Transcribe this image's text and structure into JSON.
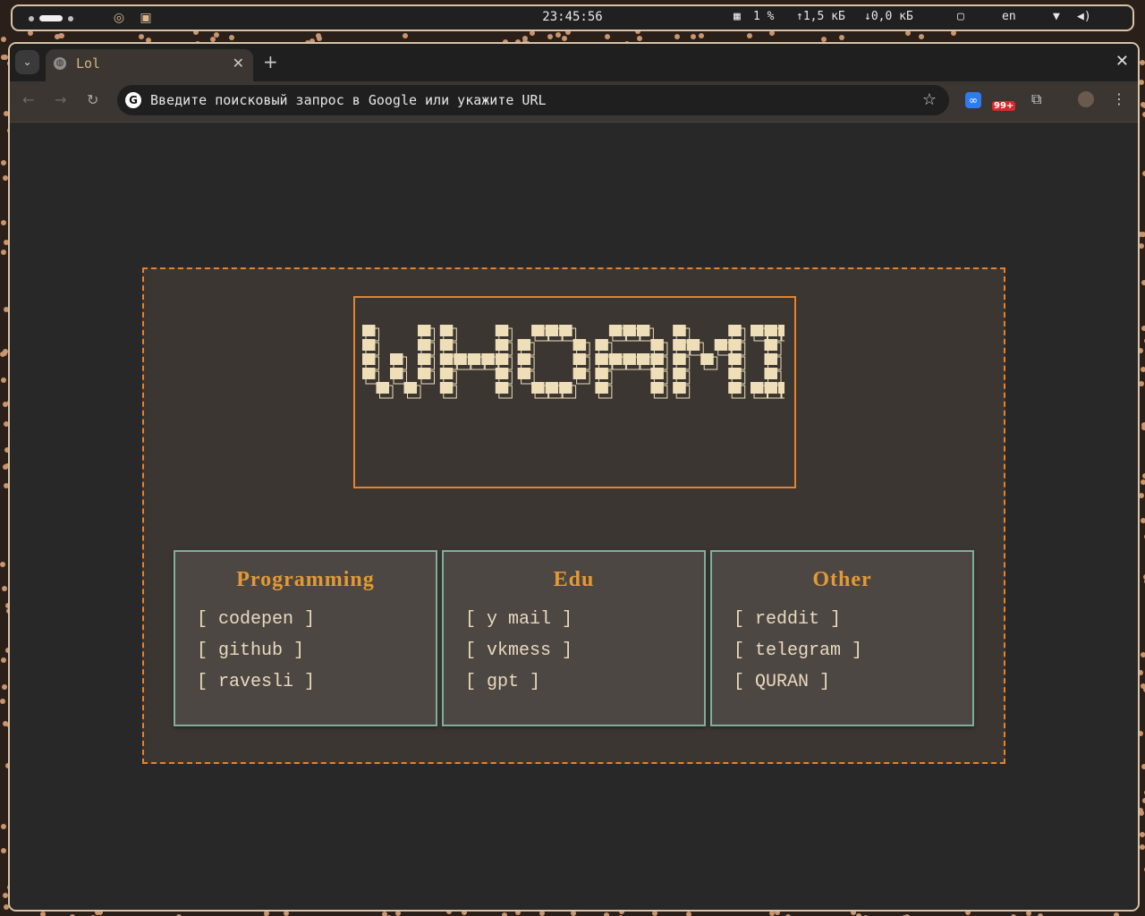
{
  "system_bar": {
    "clock": "23:45:56",
    "cpu": "1 %",
    "upload": "↑1,5 кБ",
    "download": "↓0,0 кБ",
    "layout": "en"
  },
  "browser": {
    "tab_title": "Lol",
    "omnibox_placeholder": "Введите поисковый запрос в Google или укажите URL",
    "extension_badge": "99+"
  },
  "page": {
    "banner_text": "WHOAMI",
    "sections": [
      {
        "title": "Programming",
        "links": [
          "codepen",
          "github",
          "ravesli"
        ]
      },
      {
        "title": "Edu",
        "links": [
          "y mail",
          "vkmess",
          "gpt"
        ]
      },
      {
        "title": "Other",
        "links": [
          "reddit",
          "telegram",
          "QURAN"
        ]
      }
    ]
  },
  "colors": {
    "accent_orange": "#e8822a",
    "card_border": "#7faf9c",
    "heading": "#e39a34",
    "link_text": "#ead9bf",
    "ascii_fill": "#efdfb8"
  }
}
